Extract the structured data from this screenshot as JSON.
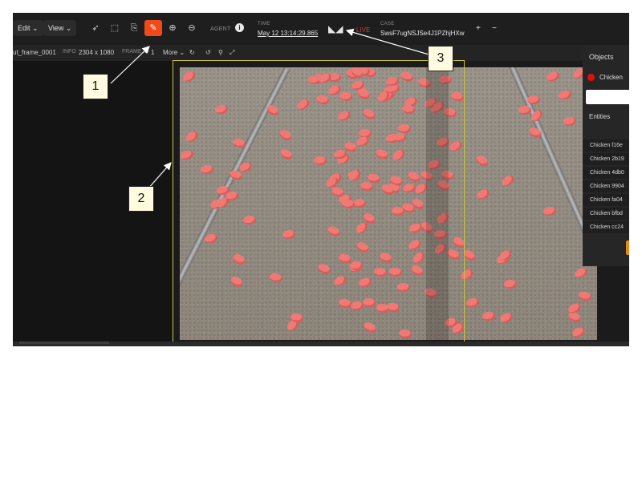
{
  "toolbar": {
    "edit_label": "Edit",
    "view_label": "View",
    "tools": [
      "send-icon",
      "box-icon",
      "segment-icon",
      "brush-icon",
      "zoom-in-icon",
      "zoom-out-icon"
    ],
    "active_tool": "brush-icon",
    "accent_color": "#f04a19",
    "agent_label": "AGENT",
    "time_label": "TIME",
    "time_value": "May 12 13:14:29.865",
    "live_label": "LIVE",
    "case_label": "CASE",
    "case_value": "SwsF7ugNSJSe4J1PZhjHXw",
    "plus": "+",
    "minus": "−"
  },
  "subbar": {
    "frame_name": "ut_frame_0001",
    "info_label": "INFO",
    "info_value": "2304 x 1080",
    "frame_id_label": "FRAME ID",
    "frame_id_value": "1",
    "more_label": "More"
  },
  "right_panel": {
    "objects_title": "Objects",
    "object_item": "Chicken",
    "object_color": "#e01010",
    "entities_title": "Entities",
    "entities": [
      "Chicken f16e",
      "Chicken 2b19",
      "Chicken 4db0",
      "Chicken 9904",
      "Chicken fa04",
      "Chicken bfbd",
      "Chicken cc24"
    ]
  },
  "callouts": [
    "1",
    "2",
    "3"
  ]
}
